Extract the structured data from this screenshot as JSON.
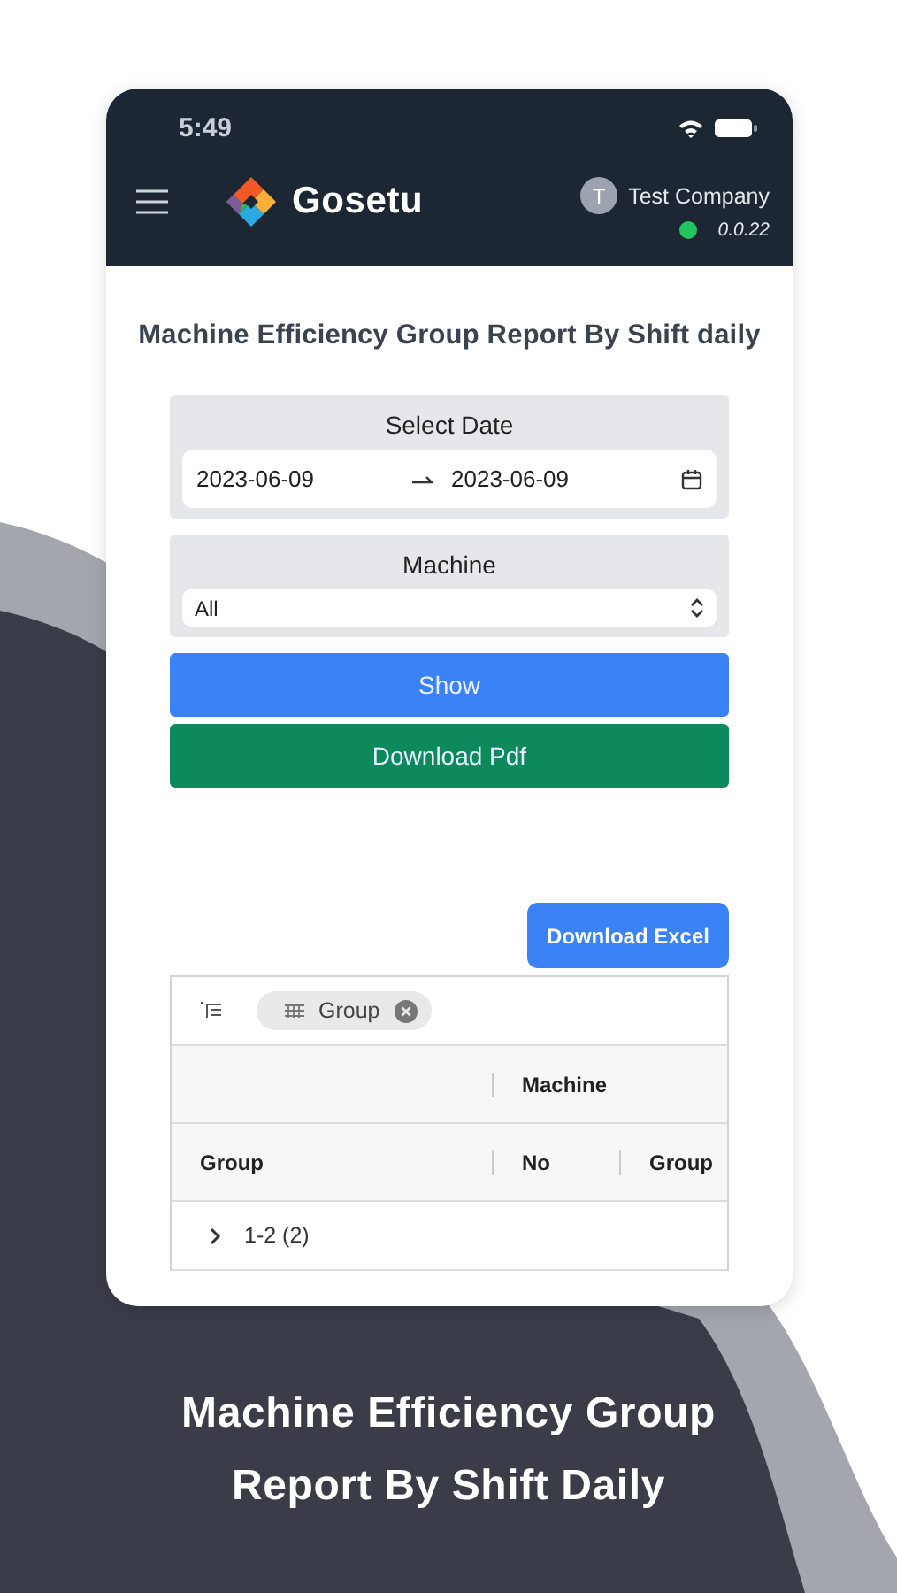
{
  "status_bar": {
    "time": "5:49"
  },
  "header": {
    "brand": "Gosetu",
    "avatar_letter": "T",
    "company": "Test Company",
    "online": true,
    "version": "0.0.22"
  },
  "title": "Machine Efficiency Group Report By Shift daily",
  "filters": {
    "date_label": "Select Date",
    "date_from": "2023-06-09",
    "date_to": "2023-06-09",
    "machine_label": "Machine",
    "machine_value": "All"
  },
  "buttons": {
    "show": "Show",
    "download_pdf": "Download Pdf",
    "download_excel": "Download Excel"
  },
  "table": {
    "group_chip": "Group",
    "header_group": "Machine",
    "columns": [
      "Group",
      "No",
      "Group"
    ],
    "rows": [
      {
        "label": "1-2 (2)",
        "expanded": false
      }
    ]
  },
  "caption": "Machine Efficiency Group Report By Shift Daily"
}
